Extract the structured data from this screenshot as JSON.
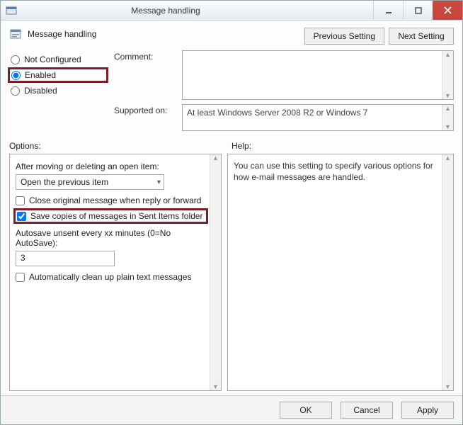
{
  "window": {
    "title": "Message handling"
  },
  "header": {
    "title": "Message handling",
    "prev_btn": "Previous Setting",
    "next_btn": "Next Setting"
  },
  "state": {
    "not_configured": "Not Configured",
    "enabled": "Enabled",
    "disabled": "Disabled",
    "selected": "enabled"
  },
  "comment": {
    "label": "Comment:",
    "value": ""
  },
  "supported": {
    "label": "Supported on:",
    "value": "At least Windows Server 2008 R2 or Windows 7"
  },
  "section_labels": {
    "options": "Options:",
    "help": "Help:"
  },
  "options": {
    "after_moving_label": "After moving or deleting an open item:",
    "after_moving_value": "Open the previous item",
    "close_original": {
      "label": "Close original message when reply or forward",
      "checked": false
    },
    "save_sent": {
      "label": "Save copies of messages in Sent Items folder",
      "checked": true
    },
    "autosave_label": "Autosave unsent every xx minutes (0=No AutoSave):",
    "autosave_value": "3",
    "auto_clean": {
      "label": "Automatically clean up plain text messages",
      "checked": false
    }
  },
  "help": {
    "text": "You can use this setting to specify various options for how e-mail messages are handled."
  },
  "footer": {
    "ok": "OK",
    "cancel": "Cancel",
    "apply": "Apply"
  }
}
